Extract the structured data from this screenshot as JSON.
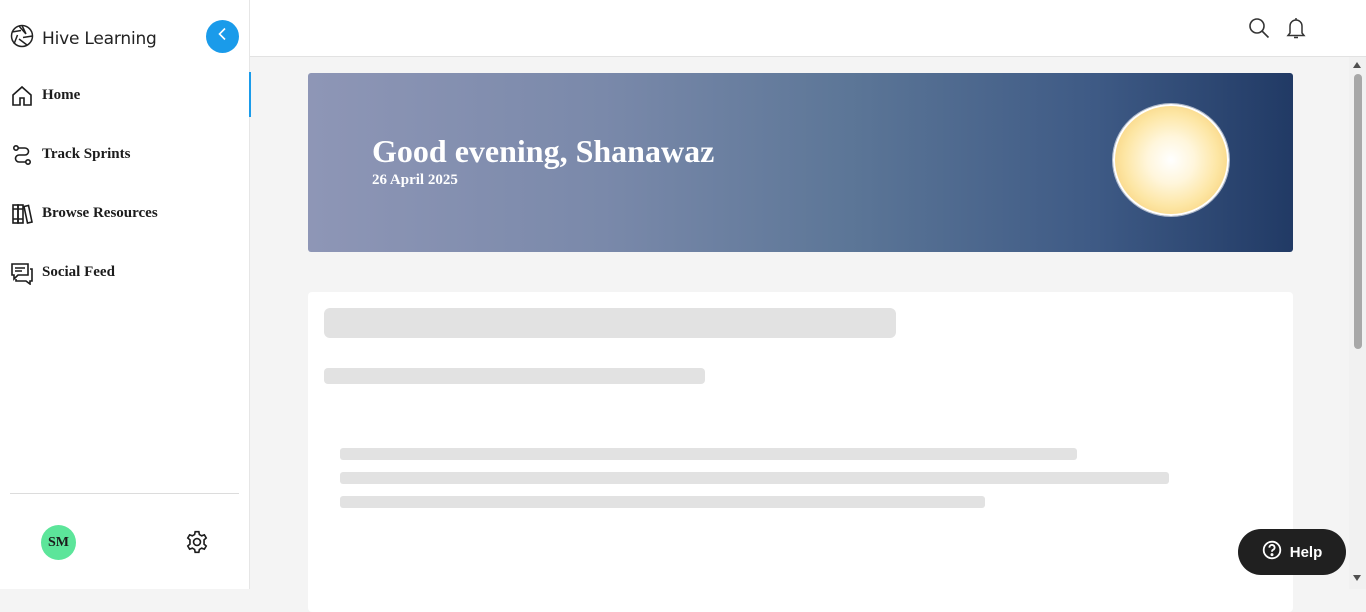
{
  "brand": {
    "name": "Hive Learning",
    "logo_icon": "hive-logo-icon"
  },
  "sidebar": {
    "collapse_icon": "chevron-left-icon",
    "items": [
      {
        "label": "Home",
        "icon": "home-icon",
        "active": true
      },
      {
        "label": "Track Sprints",
        "icon": "route-icon",
        "active": false
      },
      {
        "label": "Browse Resources",
        "icon": "books-icon",
        "active": false
      },
      {
        "label": "Social Feed",
        "icon": "chat-icon",
        "active": false
      }
    ],
    "user": {
      "initials": "SM"
    },
    "settings_icon": "gear-icon"
  },
  "topbar": {
    "search_icon": "search-icon",
    "notifications_icon": "bell-icon"
  },
  "banner": {
    "greeting": "Good evening, Shanawaz",
    "date": "26 April 2025",
    "graphic": "sun-icon"
  },
  "help": {
    "label": "Help",
    "icon": "question-circle-icon"
  },
  "colors": {
    "accent": "#1a9bea",
    "avatar": "#5ce59a",
    "banner_start": "#8e96b6",
    "banner_end": "#213a65",
    "help_bg": "#202020"
  }
}
